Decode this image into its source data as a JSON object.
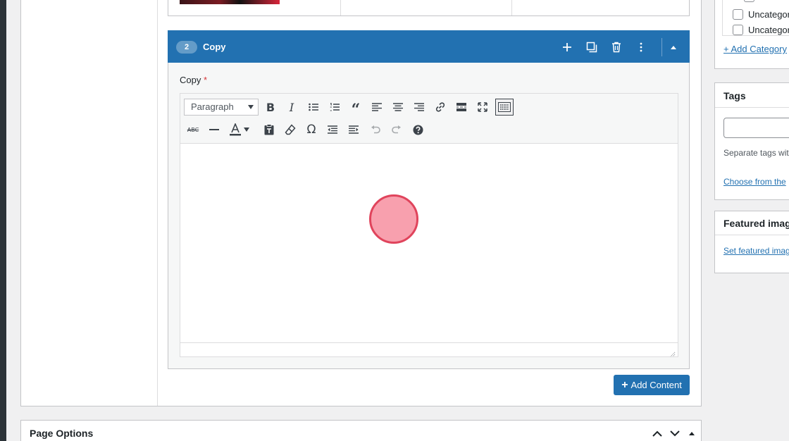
{
  "layout": {
    "number": "2",
    "title": "Copy",
    "field_label": "Copy",
    "required_mark": "*"
  },
  "editor": {
    "format_select": "Paragraph",
    "toolbar_row1": [
      "bold-icon",
      "italic-icon",
      "bullet-list-icon",
      "numbered-list-icon",
      "blockquote-icon",
      "align-left-icon",
      "align-center-icon",
      "align-right-icon",
      "link-icon",
      "read-more-icon",
      "fullscreen-icon",
      "toolbar-toggle-icon"
    ],
    "toolbar_row2": [
      "strikethrough-icon",
      "horizontal-line-icon",
      "text-color-icon",
      "paste-as-text-icon",
      "clear-formatting-icon",
      "special-character-icon",
      "outdent-icon",
      "indent-icon",
      "undo-icon",
      "redo-icon",
      "help-icon"
    ]
  },
  "buttons": {
    "add_content": "Add Content",
    "add_content_icon": "+"
  },
  "page_options": {
    "title": "Page Options"
  },
  "sidebar": {
    "categories": {
      "items": [
        "Uncategori",
        "Uncategori"
      ],
      "add_link": "+ Add Category"
    },
    "tags": {
      "title": "Tags",
      "hint": "Separate tags wit",
      "choose_link": "Choose from the"
    },
    "featured_image": {
      "title": "Featured image",
      "set_link": "Set featured imag"
    }
  },
  "colors": {
    "header_blue": "#2271b1",
    "click_marker": "#f8a0ae",
    "click_marker_border": "#e0445c"
  }
}
